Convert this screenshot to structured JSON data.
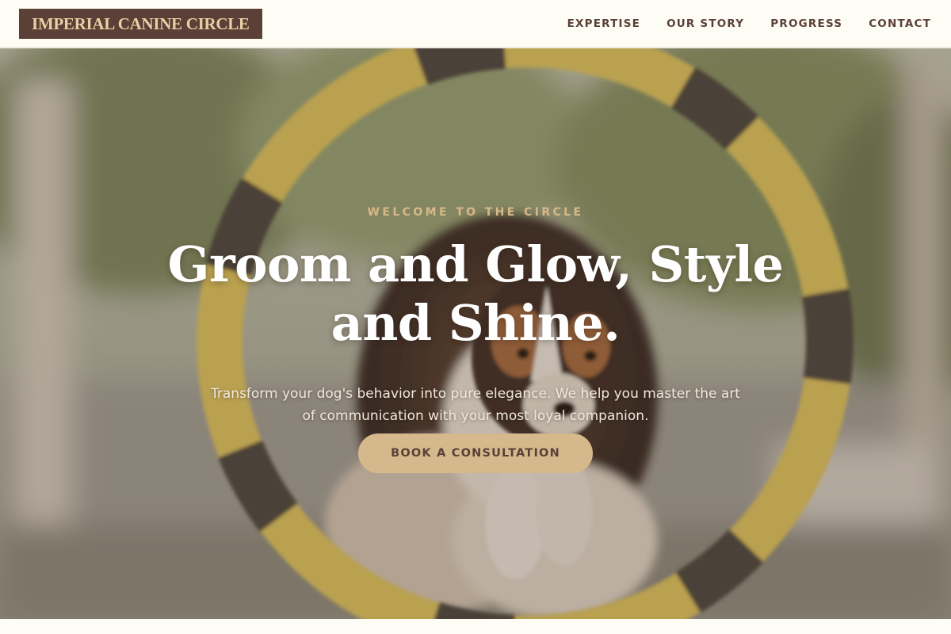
{
  "header": {
    "logo": "IMPERIAL CANINE CIRCLE",
    "nav": [
      {
        "label": "EXPERTISE"
      },
      {
        "label": "OUR STORY"
      },
      {
        "label": "PROGRESS"
      },
      {
        "label": "CONTACT"
      }
    ]
  },
  "hero": {
    "eyebrow": "WELCOME TO THE CIRCLE",
    "headline": "Groom and Glow, Style and Shine.",
    "subtext": "Transform your dog's behavior into pure elegance. We help you master the art of communication with your most loyal companion.",
    "cta_label": "BOOK A CONSULTATION",
    "photo": {
      "icon": "dog-jumping-through-agility-hoop",
      "hoop_color": "#e2c95e",
      "tape_color": "#4a443e"
    }
  },
  "colors": {
    "brand_dark": "#5b4037",
    "brand_gold": "#d6b88d",
    "background": "#fdfcf5"
  }
}
